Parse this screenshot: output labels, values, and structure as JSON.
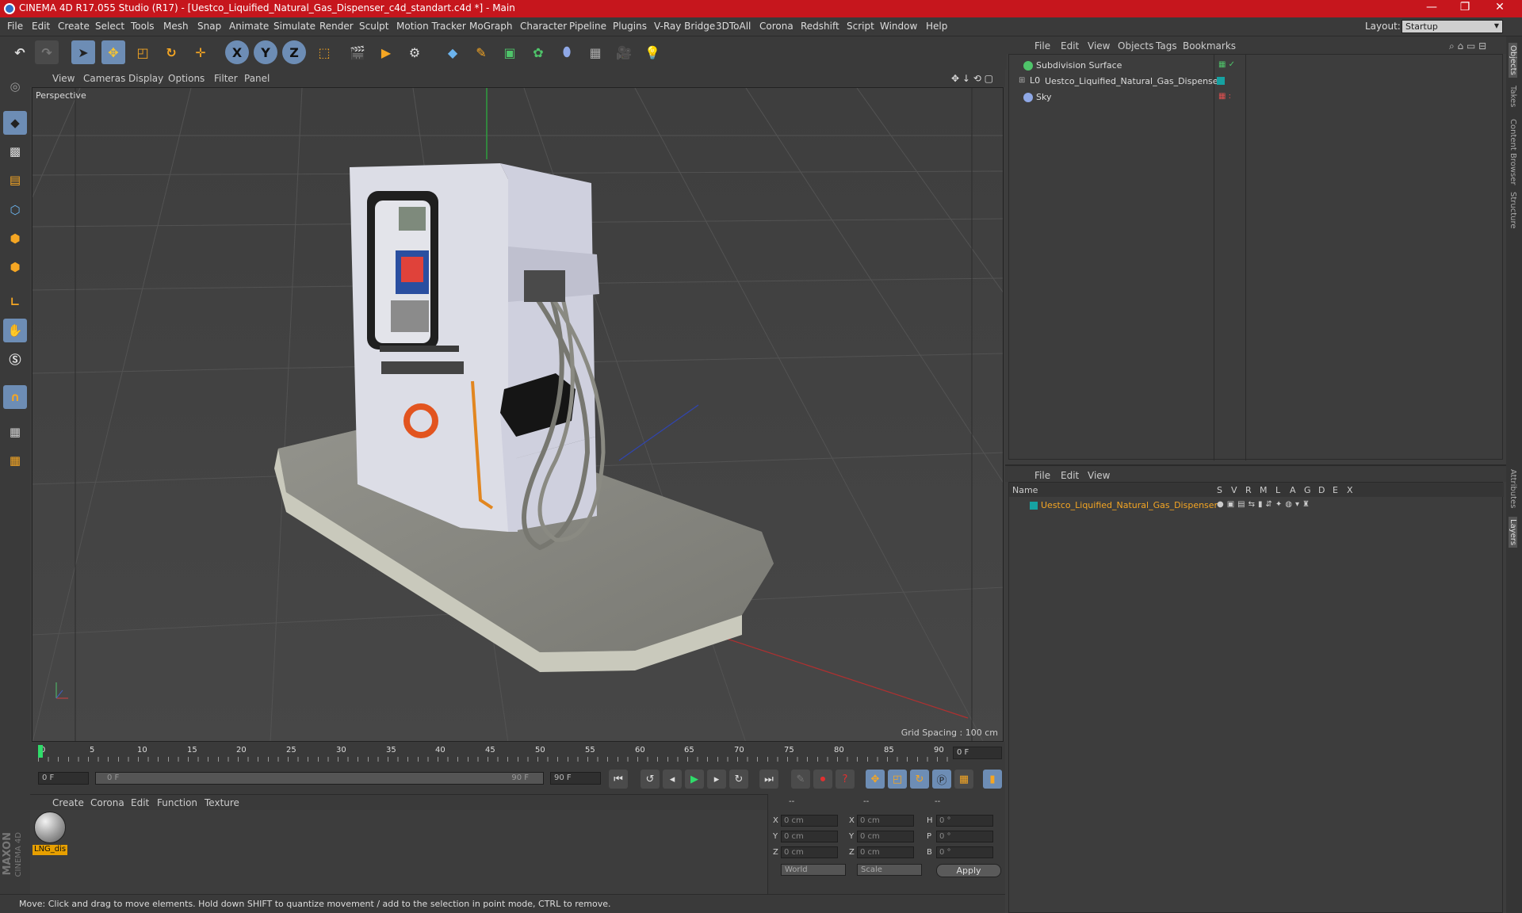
{
  "window": {
    "title": "CINEMA 4D R17.055 Studio (R17) - [Uestco_Liquified_Natural_Gas_Dispenser_c4d_standart.c4d *] - Main",
    "minimize": "—",
    "maximize": "❐",
    "close": "✕"
  },
  "menu": [
    "File",
    "Edit",
    "Create",
    "Select",
    "Tools",
    "Mesh",
    "Snap",
    "Animate",
    "Simulate",
    "Render",
    "Sculpt",
    "Motion Tracker",
    "MoGraph",
    "Character",
    "Pipeline",
    "Plugins",
    "V-Ray Bridge",
    "3DToAll",
    "Corona",
    "Redshift",
    "Script",
    "Window",
    "Help"
  ],
  "layout": {
    "label": "Layout:",
    "value": "Startup"
  },
  "toolbar": {
    "axis_x": "X",
    "axis_y": "Y",
    "axis_z": "Z"
  },
  "viewport": {
    "menu": [
      "View",
      "Cameras",
      "Display",
      "Options",
      "Filter",
      "Panel"
    ],
    "label": "Perspective",
    "grid_spacing": "Grid Spacing : 100 cm"
  },
  "timeline": {
    "ticks": [
      "0",
      "5",
      "10",
      "15",
      "20",
      "25",
      "30",
      "35",
      "40",
      "45",
      "50",
      "55",
      "60",
      "65",
      "70",
      "75",
      "80",
      "85",
      "90"
    ],
    "current_frame": "0 F"
  },
  "transport": {
    "start": "0 F",
    "range_start": "0 F",
    "range_end": "90 F",
    "end": "90 F"
  },
  "material": {
    "menu": [
      "Create",
      "Corona",
      "Edit",
      "Function",
      "Texture"
    ],
    "name": "LNG_dis"
  },
  "brand": {
    "top": "MAXON",
    "bottom": "CINEMA 4D"
  },
  "coords": {
    "header": [
      "--",
      "--",
      "--"
    ],
    "labels_pos": [
      "X",
      "Y",
      "Z"
    ],
    "labels_size": [
      "X",
      "Y",
      "Z"
    ],
    "labels_rot": [
      "H",
      "P",
      "B"
    ],
    "pos": [
      "0 cm",
      "0 cm",
      "0 cm"
    ],
    "size": [
      "0 cm",
      "0 cm",
      "0 cm"
    ],
    "rot": [
      "0 °",
      "0 °",
      "0 °"
    ],
    "mode": "World",
    "size_mode": "Scale",
    "apply": "Apply"
  },
  "status": "Move: Click and drag to move elements. Hold down SHIFT to quantize movement / add to the selection in point mode, CTRL to remove.",
  "objects": {
    "menu": [
      "File",
      "Edit",
      "View",
      "Objects",
      "Tags",
      "Bookmarks"
    ],
    "items": [
      "Subdivision Surface",
      "Uestco_Liquified_Natural_Gas_Dispenser",
      "Sky"
    ]
  },
  "layers": {
    "menu": [
      "File",
      "Edit",
      "View"
    ],
    "header": {
      "name": "Name",
      "cols": [
        "S",
        "V",
        "R",
        "M",
        "L",
        "A",
        "G",
        "D",
        "E",
        "X"
      ]
    },
    "item": "Uestco_Liquified_Natural_Gas_Dispenser"
  },
  "right_tabs": [
    "Objects",
    "Takes",
    "Content Browser",
    "Structure",
    "Attributes",
    "Layers"
  ],
  "colors": {
    "titlebar": "#c6161d",
    "accent": "#6d8db5",
    "layer_name": "#f5a623",
    "material_label": "#e8a000"
  }
}
